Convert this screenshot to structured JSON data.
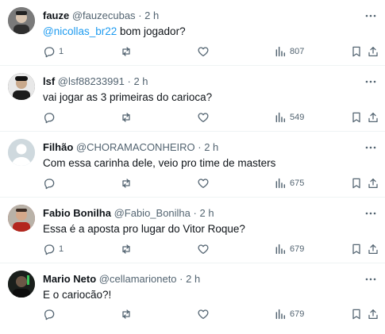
{
  "tweets": [
    {
      "name": "fauze",
      "handle": "@fauzecubas",
      "dot": "·",
      "time": "2 h",
      "mention": "@nicollas_br22",
      "text": " bom jogador?",
      "replies": "1",
      "retweets": "",
      "likes": "",
      "views": "807",
      "avatar_color": "#6b6b6b"
    },
    {
      "name": "lsf",
      "handle": "@lsf88233991",
      "dot": "·",
      "time": "2 h",
      "mention": "",
      "text": "vai jogar as 3 primeiras do carioca?",
      "replies": "",
      "retweets": "",
      "likes": "",
      "views": "549",
      "avatar_color": "#3a3a3a"
    },
    {
      "name": "Filhão",
      "handle": "@CHORAMACONHEIRO",
      "dot": "·",
      "time": "2 h",
      "mention": "",
      "text": "Com essa carinha dele, veio pro time de masters",
      "replies": "",
      "retweets": "",
      "likes": "",
      "views": "675",
      "avatar_color": "#cfd9de"
    },
    {
      "name": "Fabio Bonilha",
      "handle": "@Fabio_Bonilha",
      "dot": "·",
      "time": "2 h",
      "mention": "",
      "text": "Essa é a aposta pro lugar do Vitor Roque?",
      "replies": "1",
      "retweets": "",
      "likes": "",
      "views": "679",
      "avatar_color": "#8a2a24"
    },
    {
      "name": "Mario Neto",
      "handle": "@cellamarioneto",
      "dot": "·",
      "time": "2 h",
      "mention": "",
      "text": "E o cariocão?!",
      "replies": "",
      "retweets": "",
      "likes": "",
      "views": "679",
      "avatar_color": "#1e2a22"
    }
  ],
  "icons": {
    "more": "more-icon",
    "reply": "reply-icon",
    "retweet": "retweet-icon",
    "like": "heart-icon",
    "views": "views-icon",
    "bookmark": "bookmark-icon",
    "share": "share-icon"
  },
  "colors": {
    "text": "#0f1419",
    "secondary": "#536471",
    "link": "#1d9bf0",
    "divider": "#eff3f4"
  }
}
